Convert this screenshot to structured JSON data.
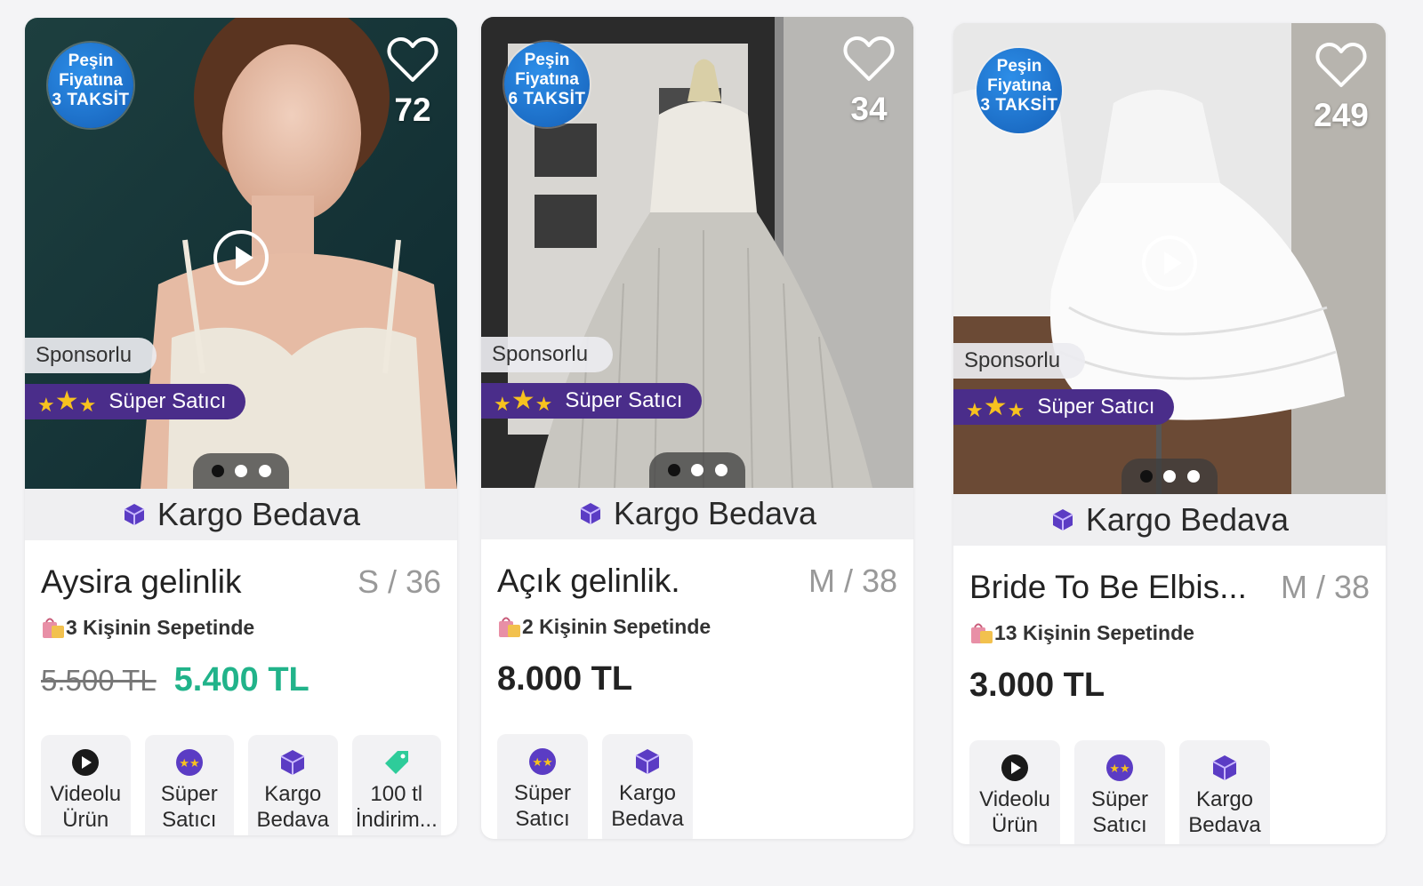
{
  "cards": [
    {
      "badge": {
        "line1": "Peşin",
        "line2": "Fiyatına",
        "line3": "3 TAKSİT"
      },
      "likes": "72",
      "sponsored": "Sponsorlu",
      "super_seller": "Süper Satıcı",
      "cargo": "Kargo Bedava",
      "title": "Aysira gelinlik",
      "size": "S / 36",
      "basket": "3 Kişinin Sepetinde",
      "old_price": "5.500 TL",
      "price": "5.400 TL",
      "chips": [
        "Videolu\nÜrün",
        "Süper\nSatıcı",
        "Kargo\nBedava",
        "100 tl\nİndirim..."
      ]
    },
    {
      "badge": {
        "line1": "Peşin",
        "line2": "Fiyatına",
        "line3": "6 TAKSİT"
      },
      "likes": "34",
      "sponsored": "Sponsorlu",
      "super_seller": "Süper Satıcı",
      "cargo": "Kargo Bedava",
      "title": "Açık gelinlik.",
      "size": "M / 38",
      "basket": "2 Kişinin Sepetinde",
      "price": "8.000 TL",
      "chips": [
        "Süper\nSatıcı",
        "Kargo\nBedava"
      ]
    },
    {
      "badge": {
        "line1": "Peşin",
        "line2": "Fiyatına",
        "line3": "3 TAKSİT"
      },
      "likes": "249",
      "sponsored": "Sponsorlu",
      "super_seller": "Süper Satıcı",
      "cargo": "Kargo Bedava",
      "title": "Bride To Be Elbis...",
      "size": "M / 38",
      "basket": "13 Kişinin Sepetinde",
      "price": "3.000 TL",
      "chips": [
        "Videolu\nÜrün",
        "Süper\nSatıcı",
        "Kargo\nBedava"
      ]
    }
  ],
  "colors": {
    "accent_purple": "#4a2d8a",
    "discount_green": "#21b38a",
    "badge_blue": "#1560b8"
  }
}
